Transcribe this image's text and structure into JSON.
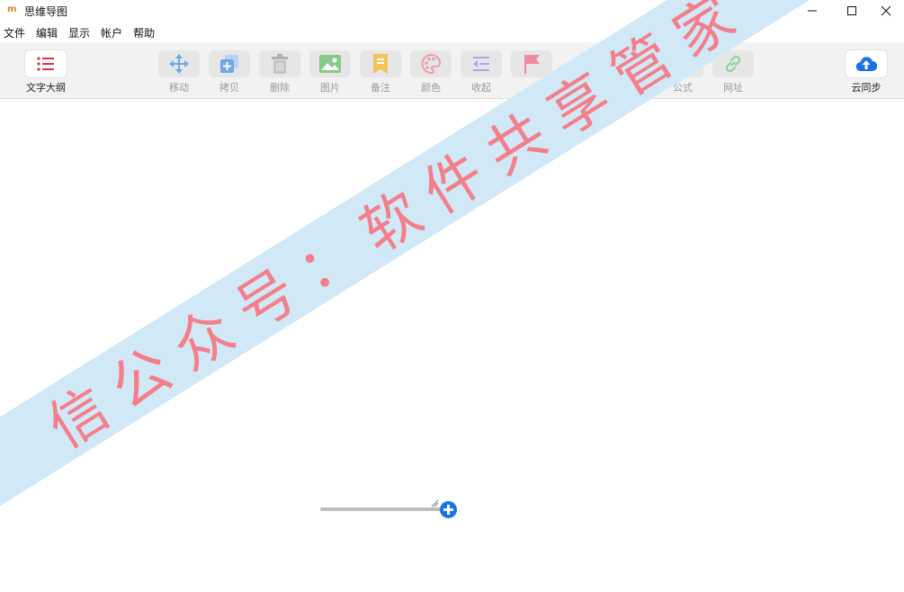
{
  "window": {
    "title": "思维导图",
    "logo_glyph": "m",
    "controls": [
      "minimize-icon",
      "maximize-icon",
      "close-icon"
    ]
  },
  "menu": [
    "文件",
    "编辑",
    "显示",
    "帐户",
    "帮助"
  ],
  "toolbar": {
    "outline": {
      "label": "文字大纲",
      "icon": "list-icon",
      "color": "#e0314b"
    },
    "move": {
      "label": "移动",
      "icon": "move-icon",
      "color": "#6fa7e8"
    },
    "copy": {
      "label": "拷贝",
      "icon": "copy-icon",
      "color": "#6fa7e8"
    },
    "delete": {
      "label": "删除",
      "icon": "trash-icon",
      "color": "#b0b0b0"
    },
    "image": {
      "label": "图片",
      "icon": "image-icon",
      "color": "#86c98a"
    },
    "note": {
      "label": "备注",
      "icon": "note-icon",
      "color": "#f2c35a"
    },
    "color": {
      "label": "颜色",
      "icon": "palette-icon",
      "color": "#e9a0a8"
    },
    "collapse": {
      "label": "收起",
      "icon": "collapse-icon",
      "color": "#b99ff2"
    },
    "flag": {
      "label": "",
      "icon": "flag-icon",
      "color": "#f08aa0"
    },
    "formula": {
      "label": "公式",
      "icon": "formula-icon",
      "color": "#b0b0b0"
    },
    "url": {
      "label": "网址",
      "icon": "link-icon",
      "color": "#8fd19e"
    },
    "sync": {
      "label": "云同步",
      "icon": "cloud-upload-icon",
      "color": "#1a73e8"
    }
  },
  "watermark": {
    "text": "信公众号：软件共享管家",
    "background": "#d1e9f7",
    "color": "#f47e8a"
  },
  "zoom": {
    "accent": "#1a73e8"
  }
}
